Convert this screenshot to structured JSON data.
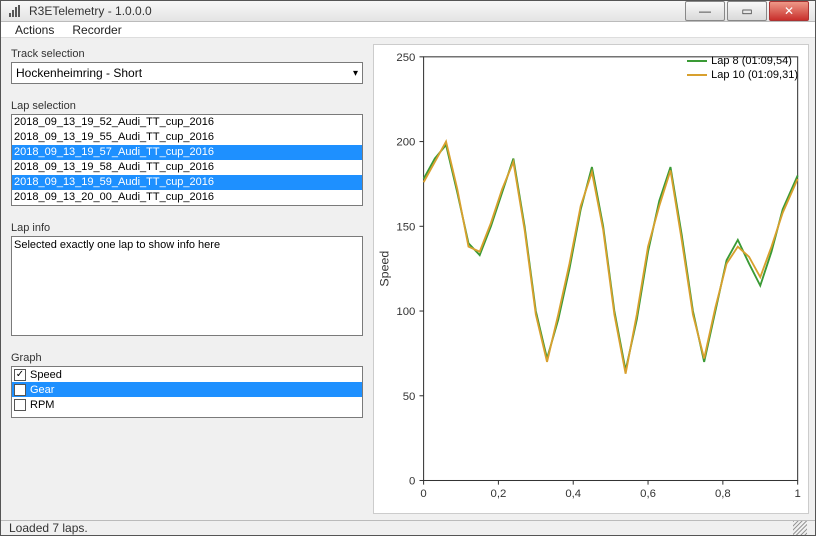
{
  "title": "R3ETelemetry - 1.0.0.0",
  "menu": {
    "actions": "Actions",
    "recorder": "Recorder"
  },
  "track": {
    "label": "Track selection",
    "value": "Hockenheimring - Short"
  },
  "lapSelection": {
    "label": "Lap selection",
    "items": [
      {
        "text": "2018_09_13_19_52_Audi_TT_cup_2016",
        "selected": false
      },
      {
        "text": "2018_09_13_19_55_Audi_TT_cup_2016",
        "selected": false
      },
      {
        "text": "2018_09_13_19_57_Audi_TT_cup_2016",
        "selected": true
      },
      {
        "text": "2018_09_13_19_58_Audi_TT_cup_2016",
        "selected": false
      },
      {
        "text": "2018_09_13_19_59_Audi_TT_cup_2016",
        "selected": true
      },
      {
        "text": "2018_09_13_20_00_Audi_TT_cup_2016",
        "selected": false
      }
    ]
  },
  "lapInfo": {
    "label": "Lap info",
    "text": "Selected exactly one lap to show info here"
  },
  "graph": {
    "label": "Graph",
    "items": [
      {
        "text": "Speed",
        "checked": true,
        "selected": false
      },
      {
        "text": "Gear",
        "checked": false,
        "selected": true
      },
      {
        "text": "RPM",
        "checked": false,
        "selected": false
      }
    ]
  },
  "status": "Loaded 7 laps.",
  "legend": {
    "s1": {
      "label": "Lap 8 (01:09,54)",
      "color": "#3a9a35"
    },
    "s2": {
      "label": "Lap 10 (01:09,31)",
      "color": "#d8a02e"
    }
  },
  "chart_data": {
    "type": "line",
    "xlabel": "",
    "ylabel": "Speed",
    "xlim": [
      0,
      1
    ],
    "ylim": [
      0,
      250
    ],
    "xticks": [
      0,
      0.2,
      0.4,
      0.6,
      0.8,
      1
    ],
    "xticklabels": [
      "0",
      "0,2",
      "0,4",
      "0,6",
      "0,8",
      "1"
    ],
    "yticks": [
      0,
      50,
      100,
      150,
      200,
      250
    ],
    "series": [
      {
        "name": "Lap 8 (01:09,54)",
        "color": "#3a9a35",
        "x": [
          0.0,
          0.03,
          0.06,
          0.09,
          0.12,
          0.15,
          0.18,
          0.21,
          0.24,
          0.27,
          0.3,
          0.33,
          0.36,
          0.39,
          0.42,
          0.45,
          0.48,
          0.51,
          0.54,
          0.57,
          0.6,
          0.63,
          0.66,
          0.69,
          0.72,
          0.75,
          0.78,
          0.81,
          0.84,
          0.87,
          0.9,
          0.93,
          0.96,
          1.0
        ],
        "y": [
          178,
          190,
          198,
          170,
          140,
          133,
          150,
          170,
          190,
          150,
          100,
          72,
          95,
          125,
          160,
          185,
          150,
          100,
          65,
          95,
          135,
          165,
          185,
          145,
          100,
          70,
          100,
          130,
          142,
          128,
          115,
          135,
          160,
          180
        ]
      },
      {
        "name": "Lap 10 (01:09,31)",
        "color": "#d8a02e",
        "x": [
          0.0,
          0.03,
          0.06,
          0.09,
          0.12,
          0.15,
          0.18,
          0.21,
          0.24,
          0.27,
          0.3,
          0.33,
          0.36,
          0.39,
          0.42,
          0.45,
          0.48,
          0.51,
          0.54,
          0.57,
          0.6,
          0.63,
          0.66,
          0.69,
          0.72,
          0.75,
          0.78,
          0.81,
          0.84,
          0.87,
          0.9,
          0.93,
          0.96,
          1.0
        ],
        "y": [
          176,
          188,
          200,
          172,
          138,
          135,
          152,
          172,
          188,
          148,
          98,
          70,
          98,
          128,
          162,
          182,
          148,
          98,
          63,
          98,
          138,
          162,
          183,
          142,
          98,
          72,
          102,
          128,
          138,
          132,
          120,
          138,
          158,
          178
        ]
      }
    ]
  }
}
